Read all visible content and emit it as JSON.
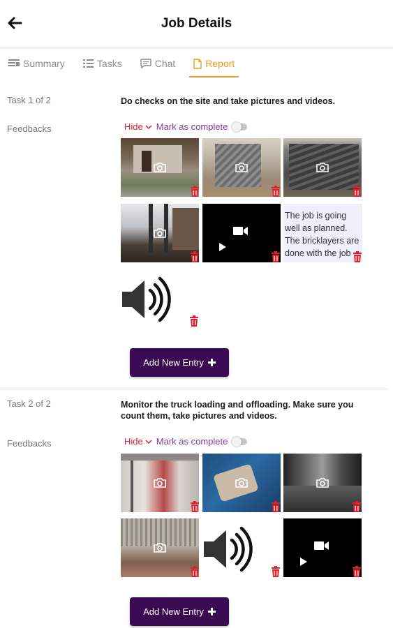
{
  "header": {
    "title": "Job Details"
  },
  "tabs": [
    {
      "label": "Summary",
      "icon": "summary-icon"
    },
    {
      "label": "Tasks",
      "icon": "tasks-icon"
    },
    {
      "label": "Chat",
      "icon": "chat-icon"
    },
    {
      "label": "Report",
      "icon": "report-icon",
      "active": true
    }
  ],
  "tasks": [
    {
      "counter": "Task 1 of 2",
      "description": "Do checks on the site and take pictures and videos.",
      "feedback_label": "Feedbacks",
      "hide_label": "Hide",
      "mark_label": "Mark as complete",
      "media": [
        {
          "type": "photo"
        },
        {
          "type": "photo"
        },
        {
          "type": "photo"
        },
        {
          "type": "photo"
        },
        {
          "type": "video"
        },
        {
          "type": "text"
        },
        {
          "type": "audio"
        }
      ],
      "note_text": "The job is going well as planned. The bricklayers are done with the job",
      "add_label": "Add New Entry"
    },
    {
      "counter": "Task 2 of 2",
      "description": "Monitor the truck loading and offloading.  Make sure you count them, take pictures and videos.",
      "feedback_label": "Feedbacks",
      "hide_label": "Hide",
      "mark_label": "Mark as complete",
      "media": [
        {
          "type": "photo"
        },
        {
          "type": "photo"
        },
        {
          "type": "photo"
        },
        {
          "type": "photo"
        },
        {
          "type": "audio"
        },
        {
          "type": "video"
        }
      ],
      "add_label": "Add New Entry"
    }
  ],
  "colors": {
    "accent": "#ef9a1c",
    "hide": "#e0202a",
    "mark": "#7e3b9e",
    "button": "#3a0a52",
    "trash": "#e0202a"
  }
}
